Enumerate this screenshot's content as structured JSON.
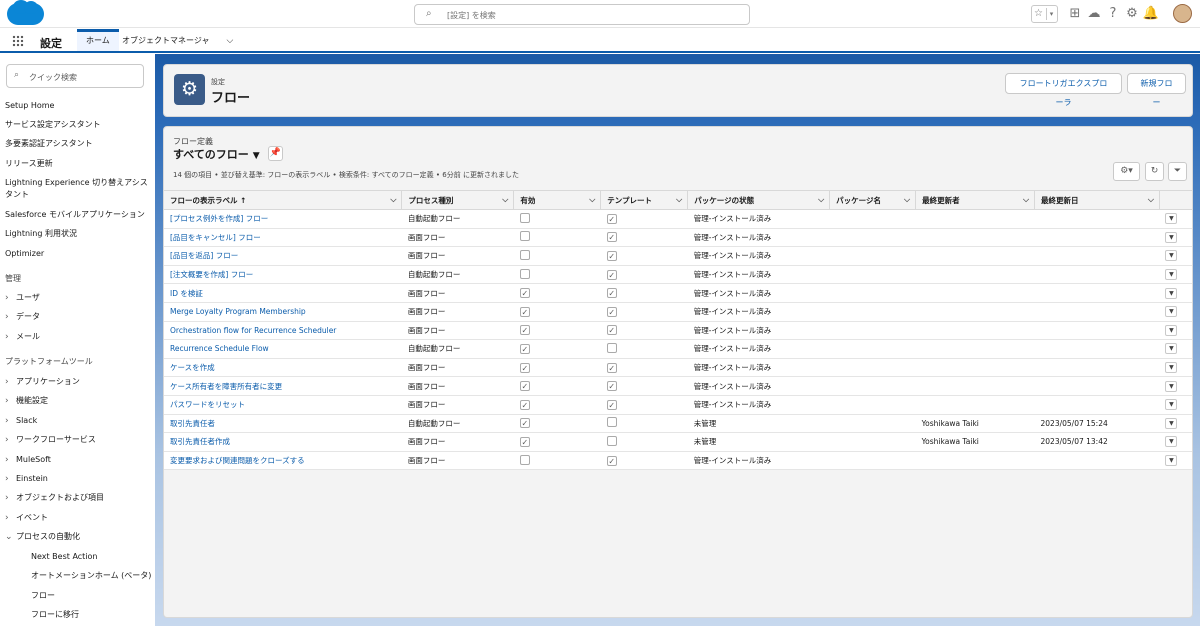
{
  "header": {
    "search_placeholder": "[設定] を検索",
    "icons": [
      "star-icon",
      "add-icon",
      "trailhead-icon",
      "help-icon",
      "gear-icon",
      "bell-icon"
    ]
  },
  "nav": {
    "app_name": "設定",
    "tabs": [
      {
        "label": "ホーム"
      },
      {
        "label": "オブジェクトマネージャ"
      }
    ]
  },
  "sidebar": {
    "quick_find_placeholder": "クイック検索",
    "items": [
      {
        "label": "Setup Home",
        "type": "link"
      },
      {
        "label": "サービス設定アシスタント",
        "type": "link"
      },
      {
        "label": "多要素認証アシスタント",
        "type": "link"
      },
      {
        "label": "リリース更新",
        "type": "link"
      },
      {
        "label": "Lightning Experience 切り替えアシスタント",
        "type": "link"
      },
      {
        "label": "Salesforce モバイルアプリケーション",
        "type": "link"
      },
      {
        "label": "Lightning 利用状況",
        "type": "link"
      },
      {
        "label": "Optimizer",
        "type": "link"
      },
      {
        "label": "管理",
        "type": "group"
      },
      {
        "label": "ユーザ",
        "type": "folder"
      },
      {
        "label": "データ",
        "type": "folder"
      },
      {
        "label": "メール",
        "type": "folder"
      },
      {
        "label": "プラットフォームツール",
        "type": "group"
      },
      {
        "label": "アプリケーション",
        "type": "folder"
      },
      {
        "label": "機能設定",
        "type": "folder"
      },
      {
        "label": "Slack",
        "type": "folder"
      },
      {
        "label": "ワークフローサービス",
        "type": "folder"
      },
      {
        "label": "MuleSoft",
        "type": "folder"
      },
      {
        "label": "Einstein",
        "type": "folder"
      },
      {
        "label": "オブジェクトおよび項目",
        "type": "folder"
      },
      {
        "label": "イベント",
        "type": "folder"
      },
      {
        "label": "プロセスの自動化",
        "type": "open-folder"
      },
      {
        "label": "Next Best Action",
        "type": "sub"
      },
      {
        "label": "オートメーションホーム (ベータ)",
        "type": "sub"
      },
      {
        "label": "フロー",
        "type": "sub"
      },
      {
        "label": "フローに移行",
        "type": "sub"
      }
    ]
  },
  "page_header": {
    "label": "設定",
    "title": "フロー",
    "buttons": [
      "フロートリガエクスプローラ",
      "新規フロー"
    ]
  },
  "list_view": {
    "object_label": "フロー定義",
    "view_name": "すべてのフロー",
    "info": "14 個の項目 • 並び替え基準: フローの表示ラベル • 検索条件: すべてのフロー定義 • 6分前 に更新されました",
    "columns": [
      "フローの表示ラベル ↑",
      "プロセス種別",
      "有効",
      "テンプレート",
      "パッケージの状態",
      "パッケージ名",
      "最終更新者",
      "最終更新日"
    ],
    "rows": [
      {
        "label": "[プロセス例外を作成] フロー",
        "type": "自動起動フロー",
        "active": false,
        "template": true,
        "pkg_state": "管理-インストール済み",
        "pkg_name": "",
        "modified_by": "",
        "modified_date": ""
      },
      {
        "label": "[品目をキャンセル] フロー",
        "type": "画面フロー",
        "active": false,
        "template": true,
        "pkg_state": "管理-インストール済み",
        "pkg_name": "",
        "modified_by": "",
        "modified_date": ""
      },
      {
        "label": "[品目を返品] フロー",
        "type": "画面フロー",
        "active": false,
        "template": true,
        "pkg_state": "管理-インストール済み",
        "pkg_name": "",
        "modified_by": "",
        "modified_date": ""
      },
      {
        "label": "[注文概要を作成] フロー",
        "type": "自動起動フロー",
        "active": false,
        "template": true,
        "pkg_state": "管理-インストール済み",
        "pkg_name": "",
        "modified_by": "",
        "modified_date": ""
      },
      {
        "label": "ID を検証",
        "type": "画面フロー",
        "active": true,
        "template": true,
        "pkg_state": "管理-インストール済み",
        "pkg_name": "",
        "modified_by": "",
        "modified_date": ""
      },
      {
        "label": "Merge Loyalty Program Membership",
        "type": "画面フロー",
        "active": true,
        "template": true,
        "pkg_state": "管理-インストール済み",
        "pkg_name": "",
        "modified_by": "",
        "modified_date": ""
      },
      {
        "label": "Orchestration flow for Recurrence Scheduler",
        "type": "画面フロー",
        "active": true,
        "template": true,
        "pkg_state": "管理-インストール済み",
        "pkg_name": "",
        "modified_by": "",
        "modified_date": ""
      },
      {
        "label": "Recurrence Schedule Flow",
        "type": "自動起動フロー",
        "active": true,
        "template": false,
        "pkg_state": "管理-インストール済み",
        "pkg_name": "",
        "modified_by": "",
        "modified_date": ""
      },
      {
        "label": "ケースを作成",
        "type": "画面フロー",
        "active": true,
        "template": true,
        "pkg_state": "管理-インストール済み",
        "pkg_name": "",
        "modified_by": "",
        "modified_date": ""
      },
      {
        "label": "ケース所有者を障害所有者に変更",
        "type": "画面フロー",
        "active": true,
        "template": true,
        "pkg_state": "管理-インストール済み",
        "pkg_name": "",
        "modified_by": "",
        "modified_date": ""
      },
      {
        "label": "パスワードをリセット",
        "type": "画面フロー",
        "active": true,
        "template": true,
        "pkg_state": "管理-インストール済み",
        "pkg_name": "",
        "modified_by": "",
        "modified_date": ""
      },
      {
        "label": "取引先責任者",
        "type": "自動起動フロー",
        "active": true,
        "template": false,
        "pkg_state": "未管理",
        "pkg_name": "",
        "modified_by": "Yoshikawa Taiki",
        "modified_date": "2023/05/07 15:24"
      },
      {
        "label": "取引先責任者作成",
        "type": "画面フロー",
        "active": true,
        "template": false,
        "pkg_state": "未管理",
        "pkg_name": "",
        "modified_by": "Yoshikawa Taiki",
        "modified_date": "2023/05/07 13:42"
      },
      {
        "label": "変更要求および関連問題をクローズする",
        "type": "画面フロー",
        "active": false,
        "template": true,
        "pkg_state": "管理-インストール済み",
        "pkg_name": "",
        "modified_by": "",
        "modified_date": ""
      }
    ]
  },
  "colors": {
    "brand": "#0b5cab",
    "cloud": "#0b86d6",
    "icon_bg": "#3a5b88"
  }
}
